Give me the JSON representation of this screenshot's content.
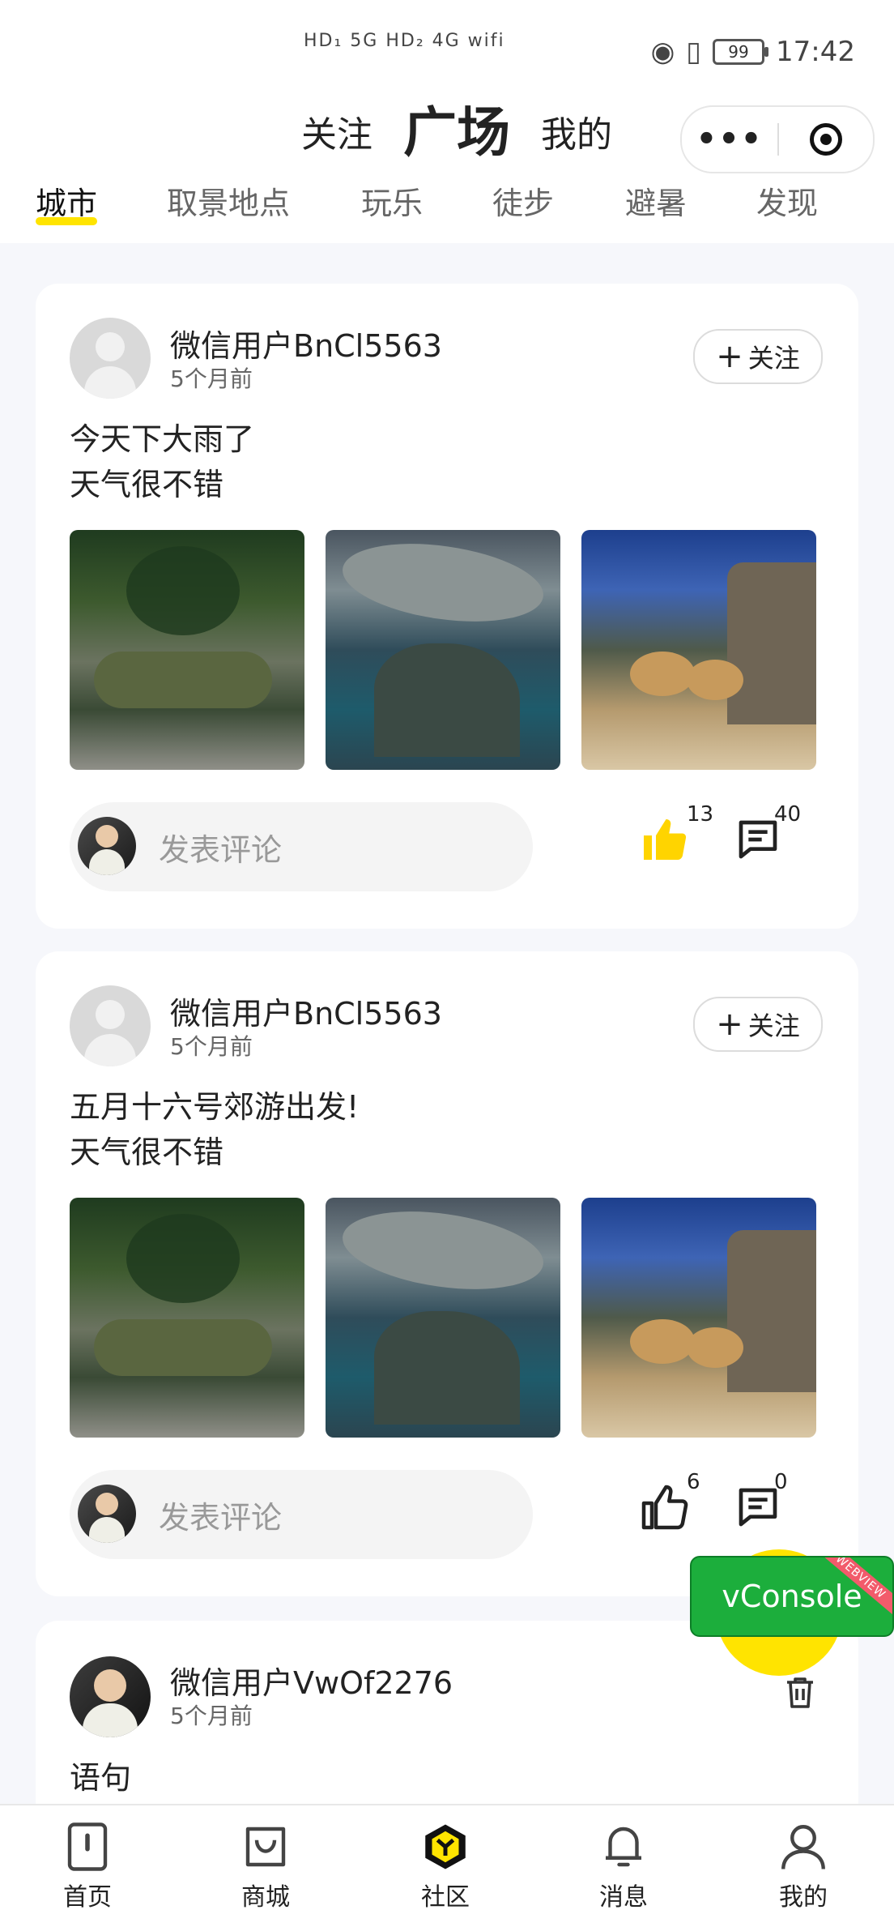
{
  "status_bar": {
    "left_indicators": "HD₁ 5G  HD₂ 4G  wifi",
    "battery": "99",
    "time": "17:42"
  },
  "header": {
    "tabs": [
      "关注",
      "广场",
      "我的"
    ],
    "active_tab": "广场",
    "capsule_more": "•••"
  },
  "categories": [
    "城市",
    "取景地点",
    "玩乐",
    "徒步",
    "避暑",
    "发现"
  ],
  "active_category": "城市",
  "posts": [
    {
      "username": "微信用户BnCl5563",
      "time": "5个月前",
      "follow_label": "关注",
      "line1": "今天下大雨了",
      "line2": "天气很不错",
      "comment_placeholder": "发表评论",
      "likes": "13",
      "comments": "40",
      "liked": true
    },
    {
      "username": "微信用户BnCl5563",
      "time": "5个月前",
      "follow_label": "关注",
      "line1": "五月十六号郊游出发!",
      "line2": "天气很不错",
      "comment_placeholder": "发表评论",
      "likes": "6",
      "comments": "0",
      "liked": false
    },
    {
      "username": "微信用户VwOf2276",
      "time": "5个月前",
      "line1": "语句"
    }
  ],
  "vconsole": {
    "label": "vConsole",
    "ribbon": "WEBVIEW"
  },
  "tabbar": [
    {
      "label": "首页",
      "icon": "home-icon"
    },
    {
      "label": "商城",
      "icon": "shopping-bag-icon"
    },
    {
      "label": "社区",
      "icon": "community-logo-icon"
    },
    {
      "label": "消息",
      "icon": "bell-icon"
    },
    {
      "label": "我的",
      "icon": "user-icon"
    }
  ],
  "colors": {
    "accent": "#ffe400",
    "vconsole": "#1cae3c",
    "background": "#f6f7fb"
  }
}
